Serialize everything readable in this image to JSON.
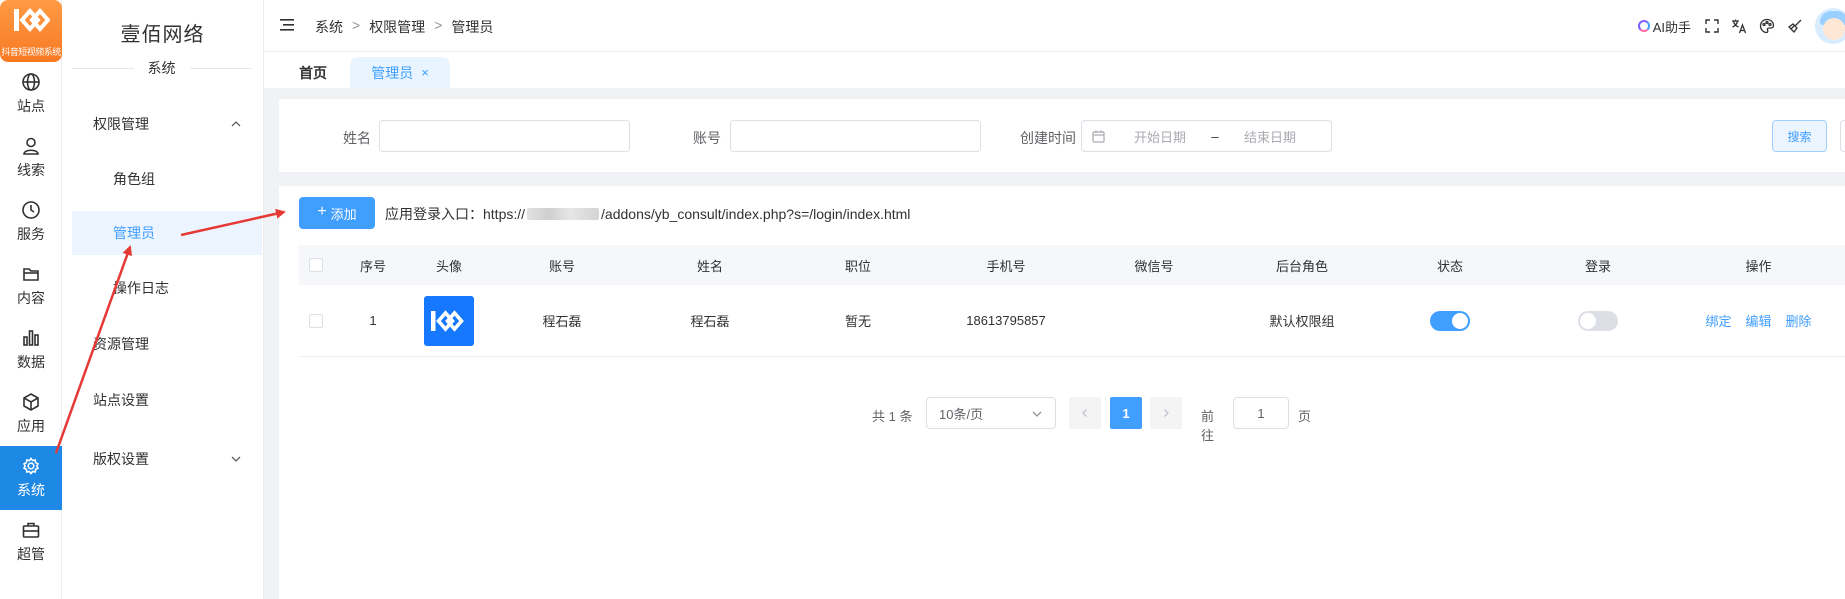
{
  "rail": {
    "logo_text": "抖音短视频系统",
    "items": [
      {
        "label": "站点",
        "icon": "globe-icon"
      },
      {
        "label": "线索",
        "icon": "user-icon"
      },
      {
        "label": "服务",
        "icon": "clock-icon"
      },
      {
        "label": "内容",
        "icon": "folder-icon"
      },
      {
        "label": "数据",
        "icon": "bar-chart-icon"
      },
      {
        "label": "应用",
        "icon": "box-icon"
      },
      {
        "label": "系统",
        "icon": "gear-icon"
      },
      {
        "label": "超管",
        "icon": "briefcase-icon"
      }
    ],
    "active_index": 6
  },
  "subside": {
    "brand": "壹佰网络",
    "section_title": "系统",
    "menu": [
      {
        "label": "权限管理"
      },
      {
        "label": "角色组"
      },
      {
        "label": "管理员"
      },
      {
        "label": "操作日志"
      },
      {
        "label": "资源管理"
      },
      {
        "label": "站点设置"
      },
      {
        "label": "版权设置"
      }
    ]
  },
  "header": {
    "breadcrumb": [
      "系统",
      "权限管理",
      "管理员"
    ],
    "breadcrumb_sep": ">",
    "ai_help": "AI助手"
  },
  "tabs": [
    {
      "label": "首页"
    },
    {
      "label": "管理员",
      "close": "×"
    }
  ],
  "search": {
    "name_label": "姓名",
    "account_label": "账号",
    "created_label": "创建时间",
    "start_placeholder": "开始日期",
    "range_sep": "–",
    "end_placeholder": "结束日期",
    "search_button": "搜索"
  },
  "toolbar": {
    "add_button": "添加",
    "add_icon": "+",
    "login_entry_prefix": "应用登录入口：https://",
    "login_entry_suffix": "/addons/yb_consult/index.php?s=/login/index.html"
  },
  "table": {
    "columns": [
      "序号",
      "头像",
      "账号",
      "姓名",
      "职位",
      "手机号",
      "微信号",
      "后台角色",
      "状态",
      "登录",
      "操作"
    ],
    "rows": [
      {
        "index": "1",
        "account": "程石磊",
        "name": "程石磊",
        "position": "暂无",
        "phone": "18613795857",
        "wechat": "",
        "role": "默认权限组",
        "status_on": true,
        "login_on": false,
        "actions": [
          "绑定",
          "编辑",
          "删除"
        ]
      }
    ]
  },
  "pagination": {
    "total": "共 1 条",
    "page_size": "10条/页",
    "current_page": "1",
    "goto_label": "前往",
    "goto_value": "1",
    "goto_unit": "页"
  },
  "colors": {
    "accent": "#409eff",
    "rail_active": "#1e88e5",
    "logo": "#f77a24",
    "arrow": "#e53935"
  }
}
